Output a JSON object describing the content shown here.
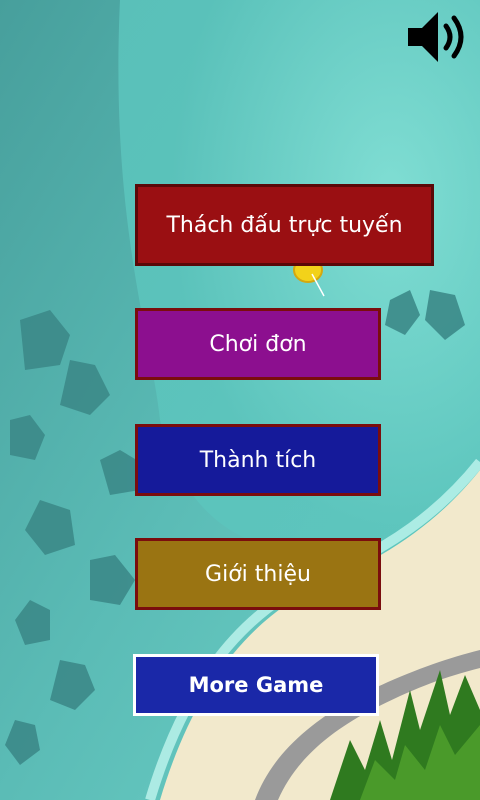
{
  "menu": {
    "online": {
      "label": "Thách đấu trực tuyến",
      "bg": "#9a0f12",
      "border": "#5a0808"
    },
    "single": {
      "label": "Chơi đơn",
      "bg": "#8c0f8f",
      "border": "#7a0d0d"
    },
    "achievements": {
      "label": "Thành tích",
      "bg": "#151a9a",
      "border": "#7a0d0d"
    },
    "about": {
      "label": "Giới thiệu",
      "bg": "#9a7412",
      "border": "#7a0d0d"
    },
    "more": {
      "label": "More Game",
      "bg": "#1a28a8",
      "border": "#ffffff"
    }
  },
  "sound": {
    "icon": "speaker-volume-icon",
    "state": "on"
  },
  "colors": {
    "sea_deep": "#3f9f9d",
    "sea_shallow": "#7ee0d6",
    "sand": "#f2e9cc",
    "road": "#9a9a9a"
  }
}
